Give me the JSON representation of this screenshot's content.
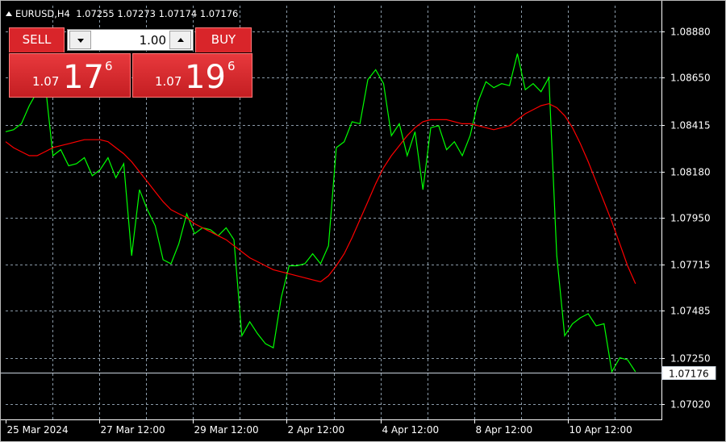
{
  "symbol": {
    "label": "EURUSD,H4",
    "ohlc": "1.07255 1.07273 1.07174 1.07176"
  },
  "trade_panel": {
    "sell_label": "SELL",
    "buy_label": "BUY",
    "lot_value": "1.00",
    "sell_price": {
      "prefix": "1.07",
      "big": "17",
      "sup": "6"
    },
    "buy_price": {
      "prefix": "1.07",
      "big": "19",
      "sup": "6"
    }
  },
  "colors": {
    "background": "#000000",
    "grid": "#8a9aa8",
    "price_line": "#00ff00",
    "moving_average": "#ff0000",
    "button_red": "#d9252a",
    "bid_line": "#c8d2dc"
  },
  "chart_data": {
    "type": "line",
    "y_ticks": [
      1.0888,
      1.0865,
      1.08415,
      1.0818,
      1.0795,
      1.07715,
      1.07485,
      1.0725,
      1.0702
    ],
    "x_tick_labels": [
      "25 Mar 2024",
      "27 Mar 12:00",
      "29 Mar 12:00",
      "2 Apr 12:00",
      "4 Apr 12:00",
      "8 Apr 12:00",
      "10 Apr 12:00"
    ],
    "ylim": [
      1.06942,
      1.0901
    ],
    "bid_price": 1.07176,
    "bid_label": "1.07176",
    "grid": true,
    "series": [
      {
        "values": [
          1.0838,
          1.0839,
          1.0842,
          1.0851,
          1.0858,
          1.0863,
          1.0826,
          1.0829,
          1.0821,
          1.0822,
          1.0825,
          1.0816,
          1.0819,
          1.0825,
          1.0815,
          1.0822,
          1.0776,
          1.0809,
          1.0799,
          1.0791,
          1.0774,
          1.0772,
          1.0782,
          1.0797,
          1.0787,
          1.079,
          1.0789,
          1.0786,
          1.079,
          1.0784,
          1.0736,
          1.0743,
          1.0737,
          1.0732,
          1.073,
          1.0755,
          1.0771,
          1.0771,
          1.0772,
          1.0777,
          1.0772,
          1.0781,
          1.083,
          1.0833,
          1.0843,
          1.0842,
          1.0864,
          1.0869,
          1.0862,
          1.0836,
          1.0842,
          1.0826,
          1.0838,
          1.0809,
          1.084,
          1.0841,
          1.0829,
          1.0833,
          1.0826,
          1.0836,
          1.0853,
          1.0863,
          1.086,
          1.0862,
          1.0861,
          1.0877,
          1.0859,
          1.0862,
          1.0858,
          1.0865,
          1.0776,
          1.0736,
          1.0742,
          1.0745,
          1.0747,
          1.0741,
          1.0742,
          1.0718,
          1.0725,
          1.0724,
          1.0718
        ]
      },
      {
        "values": [
          1.0833,
          1.083,
          1.0828,
          1.0826,
          1.0826,
          1.0828,
          1.083,
          1.0831,
          1.0832,
          1.0833,
          1.0834,
          1.0834,
          1.0834,
          1.0833,
          1.083,
          1.0827,
          1.0823,
          1.0818,
          1.0813,
          1.0808,
          1.0803,
          1.0799,
          1.0797,
          1.0795,
          1.0792,
          1.079,
          1.0788,
          1.0786,
          1.0784,
          1.0781,
          1.0778,
          1.0775,
          1.0773,
          1.0771,
          1.0769,
          1.0768,
          1.0767,
          1.0766,
          1.0765,
          1.0764,
          1.0763,
          1.0766,
          1.0771,
          1.0777,
          1.0785,
          1.0794,
          1.0803,
          1.0812,
          1.082,
          1.0826,
          1.0831,
          1.0836,
          1.084,
          1.0843,
          1.0844,
          1.0844,
          1.0844,
          1.0843,
          1.0842,
          1.0842,
          1.0841,
          1.084,
          1.0839,
          1.084,
          1.0841,
          1.0844,
          1.0847,
          1.0849,
          1.0851,
          1.0852,
          1.085,
          1.0846,
          1.084,
          1.0832,
          1.0823,
          1.0813,
          1.0803,
          1.0793,
          1.0782,
          1.0771,
          1.0762
        ]
      }
    ]
  }
}
